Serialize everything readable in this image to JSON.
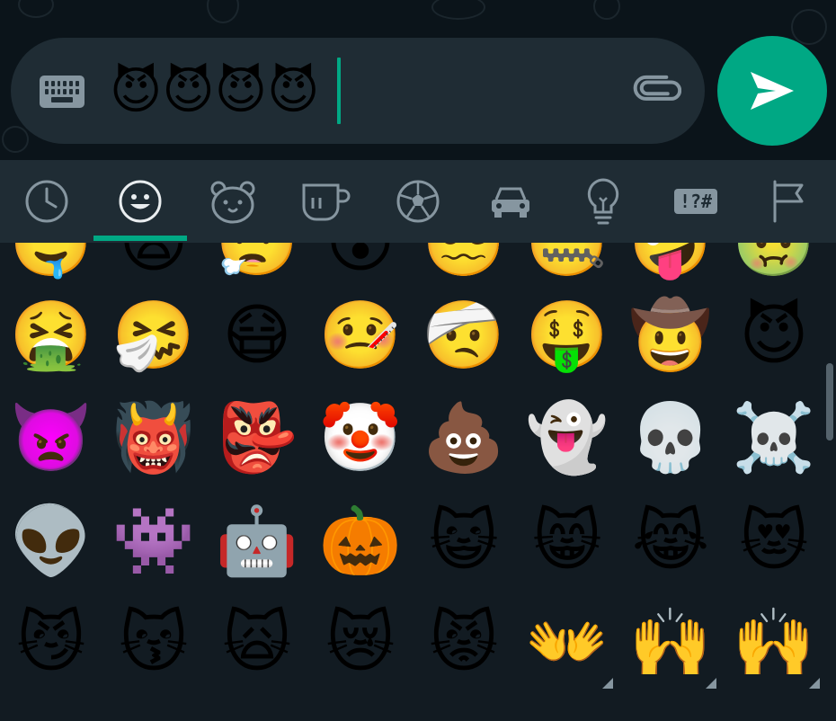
{
  "composer": {
    "input_text": "😈😈😈😈"
  },
  "categories": [
    {
      "name": "recent",
      "icon": "clock-icon"
    },
    {
      "name": "smileys",
      "icon": "smiley-icon",
      "active": true
    },
    {
      "name": "animals",
      "icon": "bear-icon"
    },
    {
      "name": "food",
      "icon": "cup-icon"
    },
    {
      "name": "activities",
      "icon": "ball-icon"
    },
    {
      "name": "travel",
      "icon": "car-icon"
    },
    {
      "name": "objects",
      "icon": "bulb-icon"
    },
    {
      "name": "symbols",
      "icon": "symbols-icon",
      "label": "!?#"
    },
    {
      "name": "flags",
      "icon": "flag-icon"
    }
  ],
  "colors": {
    "accent": "#00a884",
    "panel": "#1f2c34",
    "background": "#121b22",
    "icon": "#8696a0"
  },
  "emoji_rows": [
    [
      "🤤",
      "😪",
      "😮‍💨",
      "😵",
      "😵‍💫",
      "🤐",
      "🤪",
      "🤢"
    ],
    [
      "🤮",
      "🤧",
      "😷",
      "🤒",
      "🤕",
      "🤑",
      "🤠",
      "😈"
    ],
    [
      "👿",
      "👹",
      "👺",
      "🤡",
      "💩",
      "👻",
      "💀",
      "☠️"
    ],
    [
      "👽",
      "👾",
      "🤖",
      "🎃",
      "😺",
      "😸",
      "😹",
      "😻"
    ],
    [
      "😼",
      "😽",
      "🙀",
      "😿",
      "😾",
      "👐",
      "🙌",
      "🙌"
    ]
  ],
  "emoji_variants": {
    "row4": [
      false,
      false,
      false,
      false,
      false,
      true,
      true,
      true
    ]
  }
}
